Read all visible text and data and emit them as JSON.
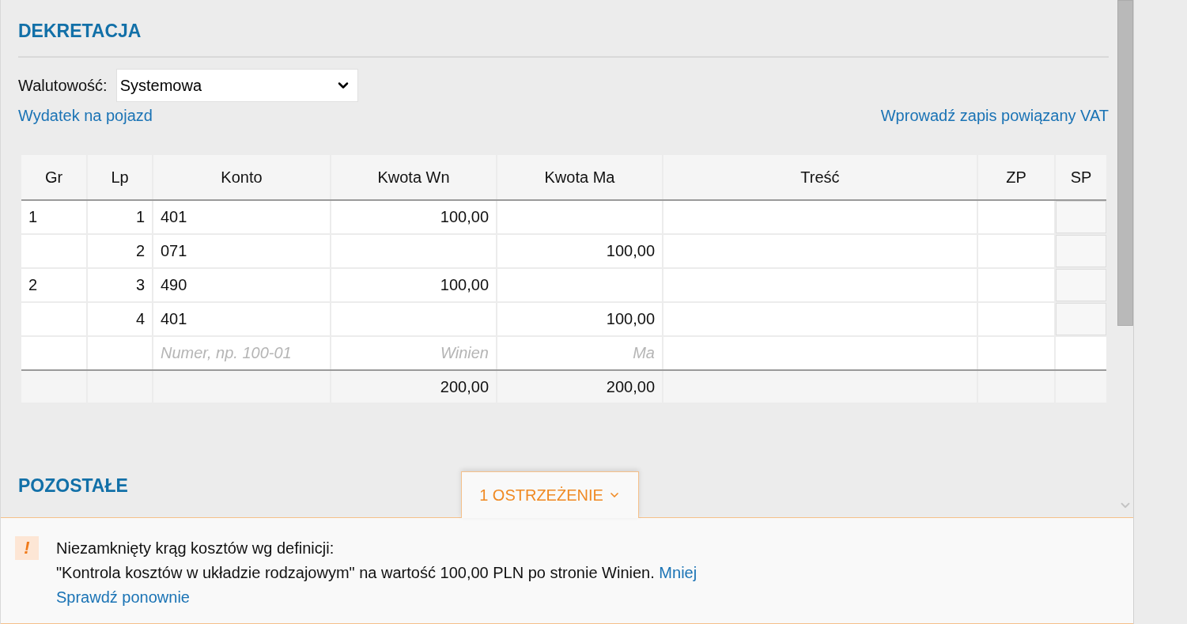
{
  "section_title": "DEKRETACJA",
  "currency": {
    "label": "Walutowość:",
    "value": "Systemowa"
  },
  "links": {
    "left": "Wydatek na pojazd",
    "right": "Wprowadź zapis powiązany VAT"
  },
  "table": {
    "columns": [
      {
        "label": "Gr"
      },
      {
        "label": "Lp"
      },
      {
        "label": "Konto"
      },
      {
        "label": "Kwota Wn"
      },
      {
        "label": "Kwota Ma"
      },
      {
        "label": "Treść"
      },
      {
        "label": "ZP"
      },
      {
        "label": "SP"
      }
    ],
    "rows": [
      {
        "cells": {
          "gr": "1",
          "lp": "1",
          "konto": "401",
          "wn": "100,00"
        }
      },
      {
        "cells": {
          "lp": "2",
          "konto": "071",
          "ma": "100,00"
        }
      },
      {
        "cells": {
          "gr": "2",
          "lp": "3",
          "konto": "490",
          "wn": "100,00"
        }
      },
      {
        "cells": {
          "lp": "4",
          "konto": "401",
          "ma": "100,00"
        }
      }
    ],
    "new_row": {
      "konto": {
        "placeholder": "Numer, np. 100-01"
      },
      "wn": {
        "placeholder": "Winien"
      },
      "ma": {
        "placeholder": "Ma"
      }
    },
    "totals": {
      "wn": "200,00",
      "ma": "200,00"
    }
  },
  "second_section_title": "POZOSTAŁE",
  "warnings": {
    "tab_label": "1 OSTRZEŻENIE",
    "expanded": true,
    "icon": "!",
    "message_lines": [
      "Niezamknięty krąg kosztów wg definicji:",
      "\"Kontrola kosztów w układzie rodzajowym\" na wartość 100,00 PLN po stronie Winien."
    ],
    "less_link": "Mniej",
    "recheck_link": "Sprawdź ponownie"
  }
}
